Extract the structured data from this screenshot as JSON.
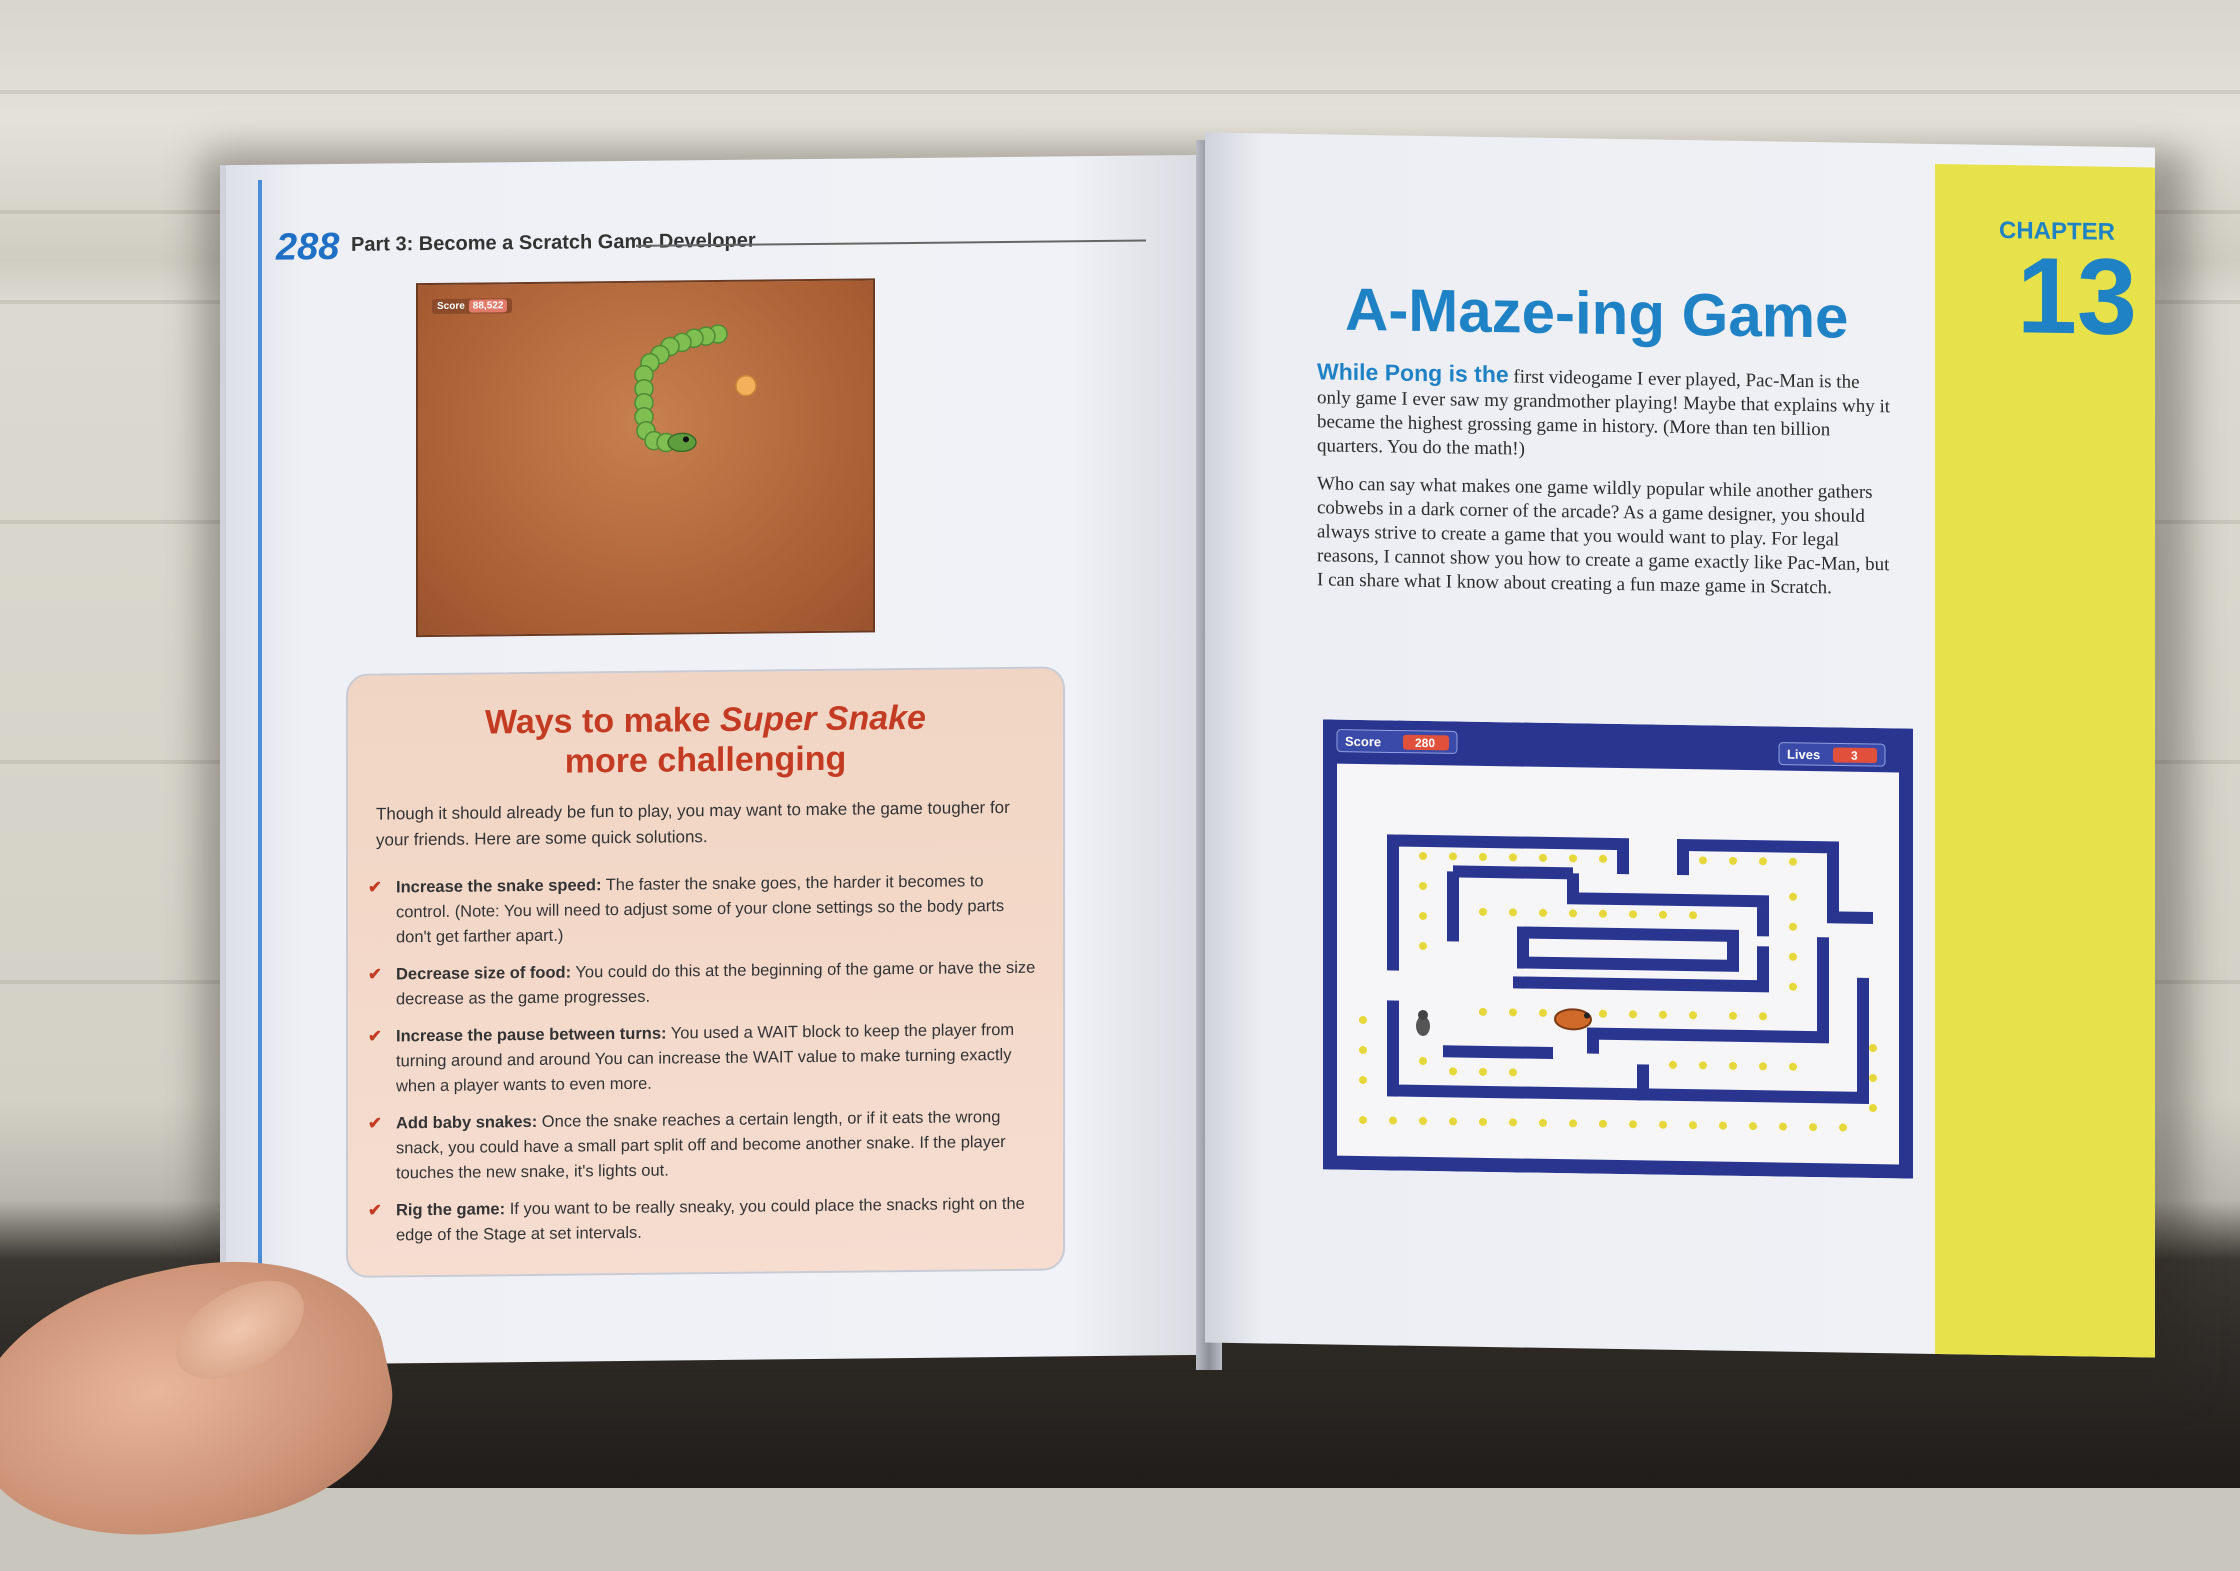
{
  "left_page": {
    "page_number": "288",
    "running_head": "Part 3: Become a Scratch Game Developer",
    "snake_screenshot": {
      "score_label": "Score",
      "score_value": "88,522"
    },
    "sidebar": {
      "title_prefix": "Ways to make ",
      "title_italic": "Super Snake",
      "title_suffix": "more challenging",
      "intro": "Though it should already be fun to play, you may want to make the game tougher for your friends. Here are some quick solutions.",
      "items": [
        {
          "bold": "Increase the snake speed:",
          "text": " The faster the snake goes, the harder it becomes to control. (Note: You will need to adjust some of your clone settings so the body parts don't get farther apart.)"
        },
        {
          "bold": "Decrease size of food:",
          "text": " You could do this at the beginning of the game or have the size decrease as the game progresses."
        },
        {
          "bold": "Increase the pause between turns:",
          "text": " You used a WAIT block to keep the player from turning around and around You can increase the WAIT value to make turning exactly when a player wants to even more."
        },
        {
          "bold": "Add baby snakes:",
          "text": " Once the snake reaches a certain length, or if it eats the wrong snack, you could have a small part split off and become another snake. If the player touches the new snake, it's lights out."
        },
        {
          "bold": "Rig the game:",
          "text": " If you want to be really sneaky, you could place the snacks right on the edge of the Stage at set intervals."
        }
      ]
    }
  },
  "right_page": {
    "chapter_word": "CHAPTER",
    "chapter_number": "13",
    "chapter_title": "A-Maze-ing Game",
    "lead": "While Pong is the",
    "paragraph1": " first videogame I ever played, Pac-Man is the only game I ever saw my grandmother playing! Maybe that explains why it became the highest grossing game in history. (More than ten billion quarters. You do the math!)",
    "paragraph2": "Who can say what makes one game wildly popular while another gathers cobwebs in a dark corner of the arcade? As a game designer, you should always strive to create a game that you would want to play. For legal reasons, I cannot show you how to create a game exactly like Pac-Man, but I can share what I know about creating a fun maze game in Scratch.",
    "maze_screenshot": {
      "score_label": "Score",
      "score_value": "280",
      "lives_label": "Lives",
      "lives_value": "3"
    }
  },
  "colors": {
    "chapter_blue": "#1f82c4",
    "sidebar_red": "#c23b22",
    "chapter_yellow": "#e8e24a",
    "maze_blue": "#2a3590",
    "dot_yellow": "#e6d83a"
  }
}
